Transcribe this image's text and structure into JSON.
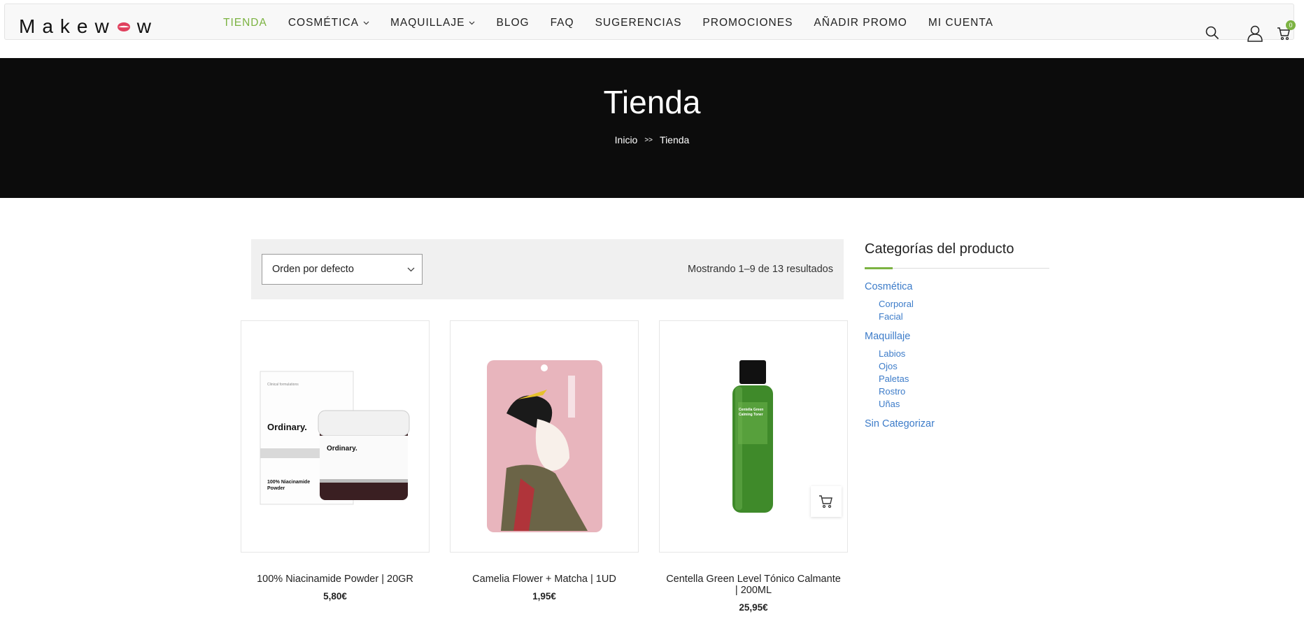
{
  "brand": {
    "logo_text_left": "Makew",
    "logo_text_right": "w",
    "accent": "#7cb342",
    "link": "#3d7cc9"
  },
  "nav": {
    "items": [
      {
        "label": "TIENDA",
        "active": true,
        "dropdown": false
      },
      {
        "label": "COSMÉTICA",
        "active": false,
        "dropdown": true
      },
      {
        "label": "MAQUILLAJE",
        "active": false,
        "dropdown": true
      },
      {
        "label": "BLOG",
        "active": false,
        "dropdown": false
      },
      {
        "label": "FAQ",
        "active": false,
        "dropdown": false
      },
      {
        "label": "SUGERENCIAS",
        "active": false,
        "dropdown": false
      },
      {
        "label": "PROMOCIONES",
        "active": false,
        "dropdown": false
      },
      {
        "label": "AÑADIR PROMO",
        "active": false,
        "dropdown": false
      },
      {
        "label": "MI CUENTA",
        "active": false,
        "dropdown": false
      }
    ],
    "icons": [
      "search-icon",
      "user-icon",
      "cart-icon"
    ],
    "cart_count": "0"
  },
  "hero": {
    "title": "Tienda",
    "breadcrumb": {
      "home": "Inicio",
      "separator": ">>",
      "current": "Tienda"
    }
  },
  "toolbar": {
    "sort_selected": "Orden por defecto",
    "results_text": "Mostrando 1–9 de 13 resultados"
  },
  "products": [
    {
      "name": "100% Niacinamide Powder | 20GR",
      "price": "5,80€"
    },
    {
      "name": "Camelia Flower + Matcha | 1UD",
      "price": "1,95€"
    },
    {
      "name": "Centella Green Level Tónico Calmante | 200ML",
      "price": "25,95€"
    }
  ],
  "sidebar": {
    "title": "Categorías del producto",
    "categories": [
      {
        "label": "Cosmética",
        "children": [
          "Corporal",
          "Facial"
        ]
      },
      {
        "label": "Maquillaje",
        "children": [
          "Labios",
          "Ojos",
          "Paletas",
          "Rostro",
          "Uñas"
        ]
      },
      {
        "label": "Sin Categorizar",
        "children": []
      }
    ]
  }
}
